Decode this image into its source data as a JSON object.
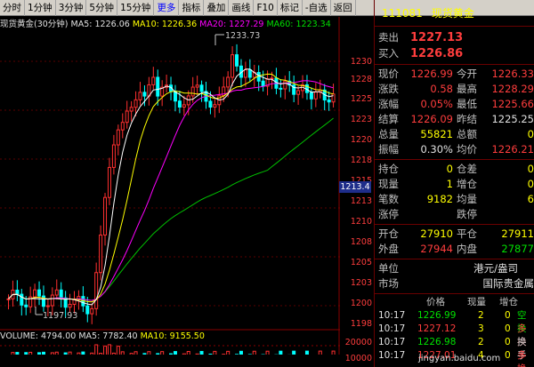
{
  "toolbar": {
    "items": [
      "分时",
      "1分钟",
      "3分钟",
      "5分钟",
      "15分钟",
      "更多",
      "指标",
      "叠加",
      "画线",
      "F10",
      "标记",
      "-自选",
      "返回"
    ]
  },
  "chart": {
    "name": "现货黄金(30分钟)",
    "ma5": "MA5: 1226.06",
    "ma10": "MA10: 1226.36",
    "ma20": "MA20: 1227.29",
    "ma60": "MA60: 1223.34",
    "high_label": "1233.73",
    "low_label": "1197.93",
    "current_price_tag": "1213.4",
    "price_ticks": [
      "1230",
      "1228",
      "1225",
      "1223",
      "1220",
      "1218",
      "1215",
      "1213",
      "1210",
      "1208",
      "1205",
      "1203",
      "1200",
      "1198"
    ],
    "volume_info": "VOLUME: 4794.00",
    "vol_ma5": "MA5: 7782.40",
    "vol_ma10": "MA10: 9155.50",
    "vol_ticks": [
      "20000",
      "10000"
    ],
    "colors": {
      "ma5": "#ffffff",
      "ma10": "#ffff00",
      "ma20": "#ff00ff",
      "ma60": "#00c000",
      "up": "#ff3030",
      "down": "#00ffff"
    }
  },
  "panel": {
    "code": "111081",
    "name": "现货黄金",
    "sell_label": "卖出",
    "sell": "1227.13",
    "buy_label": "买入",
    "buy": "1226.86",
    "rows": [
      {
        "l1": "现价",
        "v1": "1226.99",
        "c1": "red",
        "l2": "今开",
        "v2": "1226.33",
        "c2": "red"
      },
      {
        "l1": "涨跌",
        "v1": "0.58",
        "c1": "red",
        "l2": "最高",
        "v2": "1228.29",
        "c2": "red"
      },
      {
        "l1": "涨幅",
        "v1": "0.05%",
        "c1": "red",
        "l2": "最低",
        "v2": "1225.66",
        "c2": "red"
      },
      {
        "l1": "结算",
        "v1": "1226.09",
        "c1": "red",
        "l2": "昨结",
        "v2": "1225.25",
        "c2": "wht"
      },
      {
        "l1": "总量",
        "v1": "55821",
        "c1": "yel",
        "l2": "总额",
        "v2": "0",
        "c2": "yel"
      },
      {
        "l1": "振幅",
        "v1": "0.30%",
        "c1": "wht",
        "l2": "均价",
        "v2": "1226.21",
        "c2": "red"
      }
    ],
    "rows2": [
      {
        "l1": "持仓",
        "v1": "0",
        "c1": "yel",
        "l2": "仓差",
        "v2": "0",
        "c2": "yel"
      },
      {
        "l1": "现量",
        "v1": "1",
        "c1": "yel",
        "l2": "增仓",
        "v2": "0",
        "c2": "yel"
      },
      {
        "l1": "笔数",
        "v1": "9182",
        "c1": "yel",
        "l2": "均量",
        "v2": "6",
        "c2": "yel"
      },
      {
        "l1": "涨停",
        "v1": "",
        "c1": "wht",
        "l2": "跌停",
        "v2": "",
        "c2": "wht"
      }
    ],
    "rows3": [
      {
        "l1": "开仓",
        "v1": "27910",
        "c1": "yel",
        "l2": "平仓",
        "v2": "27911",
        "c2": "yel"
      },
      {
        "l1": "外盘",
        "v1": "27944",
        "c1": "red",
        "l2": "内盘",
        "v2": "27877",
        "c2": "green"
      }
    ],
    "unit_label": "单位",
    "unit": "港元/盎司",
    "market_label": "市场",
    "market": "国际贵金属",
    "trade_headers": [
      "价格",
      "现量",
      "增仓"
    ],
    "trades": [
      {
        "t": "10:17",
        "p": "1226.99",
        "v": "2",
        "o": "0",
        "k": "空换"
      },
      {
        "t": "10:17",
        "p": "1227.12",
        "v": "3",
        "o": "0",
        "k": "多换"
      },
      {
        "t": "10:17",
        "p": "1226.98",
        "v": "2",
        "o": "0",
        "k": "换手"
      },
      {
        "t": "10:17",
        "p": "1227.01",
        "v": "4",
        "o": "0",
        "k": "多换"
      }
    ]
  },
  "watermark": "jingyan.baidu.com"
}
